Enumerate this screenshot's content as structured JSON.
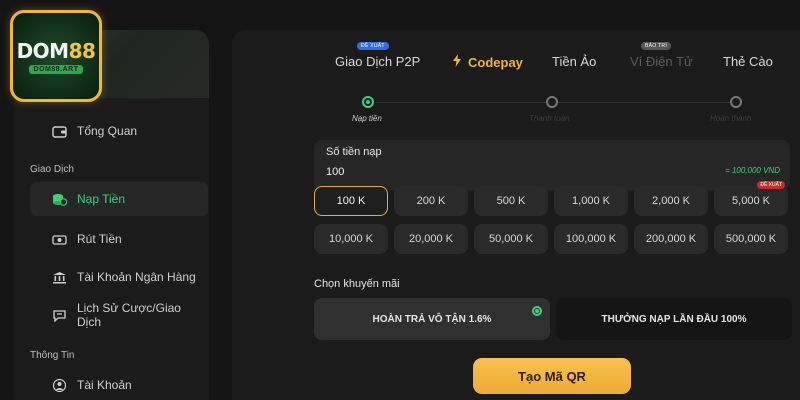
{
  "logo": {
    "main_left": "DOM",
    "main_right": "88",
    "sub": "DOM88.ART"
  },
  "sidebar": {
    "items": [
      {
        "label": "Tổng Quan",
        "icon": "wallet-icon"
      },
      {
        "label": "Nạp Tiền",
        "icon": "deposit-coins-icon",
        "active": true
      },
      {
        "label": "Rút Tiền",
        "icon": "withdraw-cash-icon"
      },
      {
        "label": "Tài Khoản Ngân Hàng",
        "icon": "bank-icon"
      },
      {
        "label": "Lịch Sử Cược/Giao Dịch",
        "icon": "history-chat-icon"
      },
      {
        "label": "Tài Khoản",
        "icon": "user-icon"
      }
    ],
    "sections": {
      "transactions": "Giao Dịch",
      "info": "Thông Tin"
    }
  },
  "tabs": [
    {
      "label": "Giao Dịch P2P",
      "badge": "ĐỀ XUẤT"
    },
    {
      "label": "Codepay",
      "active": true,
      "icon": "lightning-icon"
    },
    {
      "label": "Tiền Ảo"
    },
    {
      "label": "Ví Điện Tử",
      "badge": "BẢO TRÌ",
      "disabled": true
    },
    {
      "label": "Thẻ Cào"
    }
  ],
  "steps": [
    {
      "label": "Nạp tiền",
      "active": true
    },
    {
      "label": "Thanh toán"
    },
    {
      "label": "Hoàn thành"
    }
  ],
  "amount_field": {
    "label": "Số tiền nạp",
    "value": "100",
    "equivalent": "= 100,000 VND"
  },
  "amounts": [
    {
      "label": "100 K",
      "selected": true
    },
    {
      "label": "200 K"
    },
    {
      "label": "500 K"
    },
    {
      "label": "1,000 K"
    },
    {
      "label": "2,000 K"
    },
    {
      "label": "5,000 K",
      "badge": "ĐỀ XUẤT"
    },
    {
      "label": "10,000 K"
    },
    {
      "label": "20,000 K"
    },
    {
      "label": "50,000 K"
    },
    {
      "label": "100,000 K"
    },
    {
      "label": "200,000 K"
    },
    {
      "label": "500,000 K"
    }
  ],
  "promo": {
    "label": "Chọn khuyến mãi",
    "options": [
      {
        "label": "HOÀN TRẢ VÔ TẬN 1.6%",
        "selected": true
      },
      {
        "label": "THƯỞNG NẠP LẦN ĐẦU 100%"
      }
    ]
  },
  "submit_label": "Tạo Mã QR",
  "colors": {
    "accent": "#f0b33c",
    "active_green": "#3fd07a",
    "badge_blue": "#2f6fe6",
    "badge_red": "#c82b2b"
  }
}
